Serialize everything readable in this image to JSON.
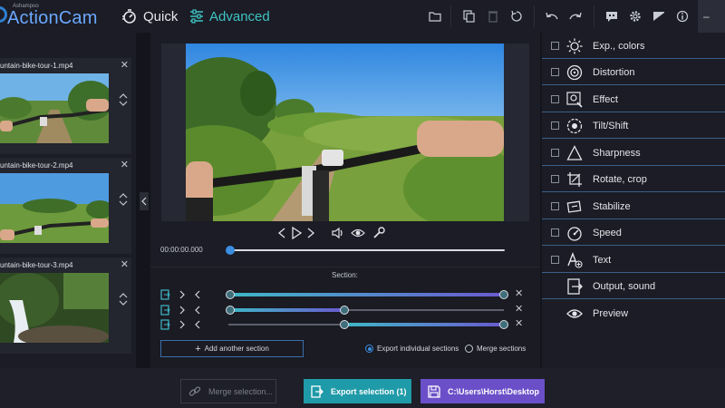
{
  "app": {
    "brand": "Ashampoo",
    "name": "ActionCam"
  },
  "modes": {
    "quick": "Quick",
    "advanced": "Advanced"
  },
  "toolbar_icons": [
    "folder-icon",
    "copy-icon",
    "trash-icon",
    "reset-icon",
    "undo-icon",
    "redo-icon",
    "subtitle-icon",
    "gear-icon",
    "image-icon",
    "info-icon"
  ],
  "window": {
    "minimize": "–"
  },
  "clips": [
    {
      "title": "untain-bike-tour-1.mp4"
    },
    {
      "title": "untain-bike-tour-2.mp4"
    },
    {
      "title": "untain-bike-tour-3.mp4"
    }
  ],
  "player": {
    "timecode": "00:00:00.000"
  },
  "section": {
    "label": "Section:"
  },
  "add_section": "Add another section",
  "export_options": {
    "individual": "Export individual sections",
    "merge": "Merge sections"
  },
  "right_menu": [
    {
      "label": "Exp., colors",
      "icon": "sun-icon",
      "checkbox": true
    },
    {
      "label": "Distortion",
      "icon": "lens-icon",
      "checkbox": true
    },
    {
      "label": "Effect",
      "icon": "effect-icon",
      "checkbox": true
    },
    {
      "label": "Tilt/Shift",
      "icon": "tilt-shift-icon",
      "checkbox": true
    },
    {
      "label": "Sharpness",
      "icon": "triangle-icon",
      "checkbox": true
    },
    {
      "label": "Rotate, crop",
      "icon": "crop-icon",
      "checkbox": true
    },
    {
      "label": "Stabilize",
      "icon": "stabilize-icon",
      "checkbox": true
    },
    {
      "label": "Speed",
      "icon": "speedometer-icon",
      "checkbox": true
    },
    {
      "label": "Text",
      "icon": "text-icon",
      "checkbox": true
    },
    {
      "label": "Output, sound",
      "icon": "output-icon",
      "checkbox": false
    },
    {
      "label": "Preview",
      "icon": "eye-icon",
      "checkbox": false
    }
  ],
  "bottom": {
    "merge": "Merge selection...",
    "export": "Export selection (1)",
    "path": "C:\\Users\\Horst\\Desktop"
  },
  "colors": {
    "accent_teal": "#1f9aa8",
    "accent_purple": "#6b4fc8",
    "accent_blue": "#3b8ee0"
  }
}
